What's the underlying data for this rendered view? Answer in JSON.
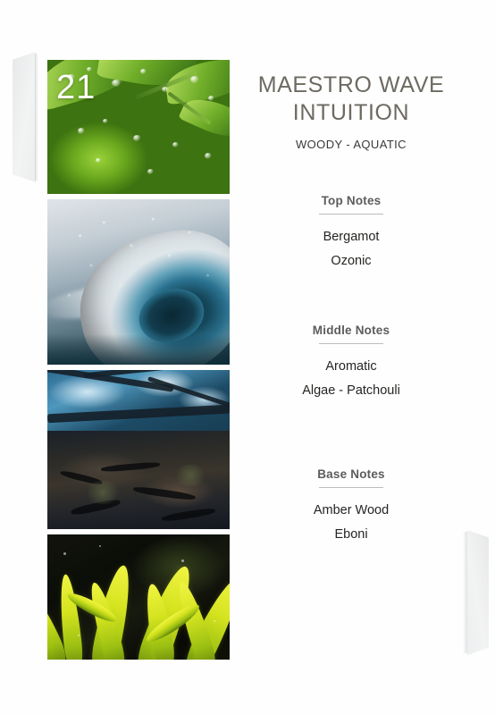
{
  "card": {
    "index_label": "21",
    "fragrance_name": "MAESTRO WAVE INTUITION",
    "fragrance_family": "WOODY - AQUATIC",
    "accent_heading_color": "#5c5c5c",
    "title_color": "#6d6a61",
    "body_text_color": "#262523",
    "rule_color": "#bdbdbd",
    "background_color": "#fefefe"
  },
  "photos": [
    {
      "alt": "green bergamot citrus fruits with water droplets on leaves",
      "overlay_number": "21",
      "dominant_color": "#6aa81e"
    },
    {
      "alt": "ocean wave barrel breaking with sea spray",
      "dominant_color": "#7b94a3"
    },
    {
      "alt": "dark tree bark seen looking upward with sky through canopy",
      "dominant_color": "#2a2a28"
    },
    {
      "alt": "yellow green algae seagrass blades in dark water",
      "dominant_color": "#d4e31f"
    }
  ],
  "notes": [
    {
      "heading": "Top Notes",
      "items": [
        "Bergamot",
        "Ozonic"
      ]
    },
    {
      "heading": "Middle Notes",
      "items": [
        "Aromatic",
        "Algae - Patchouli"
      ]
    },
    {
      "heading": "Base Notes",
      "items": [
        "Amber Wood",
        "Eboni"
      ]
    }
  ]
}
